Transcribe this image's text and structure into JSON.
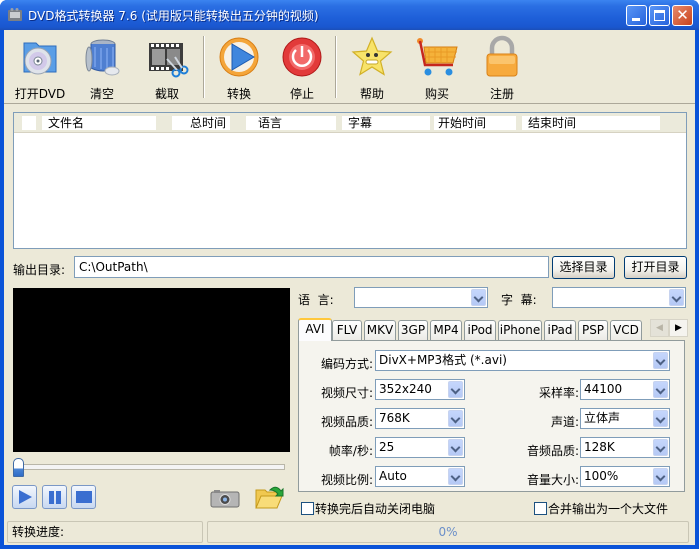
{
  "window": {
    "title": "DVD格式转换器 7.6 (试用版只能转换出五分钟的视频)",
    "controls": {
      "minimize": "minimize",
      "maximize": "maximize",
      "close": "✕"
    }
  },
  "toolbar": {
    "items": [
      {
        "label": "打开DVD",
        "icon": "open-dvd-icon"
      },
      {
        "label": "清空",
        "icon": "trash-icon"
      },
      {
        "label": "截取",
        "icon": "film-cut-icon"
      },
      {
        "label": "转换",
        "icon": "play-convert-icon"
      },
      {
        "label": "停止",
        "icon": "stop-power-icon"
      },
      {
        "label": "帮助",
        "icon": "star-help-icon"
      },
      {
        "label": "购买",
        "icon": "cart-icon"
      },
      {
        "label": "注册",
        "icon": "lock-icon"
      }
    ]
  },
  "file_list": {
    "columns": [
      "文件名",
      "总时间",
      "语言",
      "字幕",
      "开始时间",
      "结束时间"
    ],
    "rows": []
  },
  "output": {
    "label": "输出目录:",
    "path": "C:\\OutPath\\",
    "choose_button": "选择目录",
    "open_button": "打开目录"
  },
  "player": {
    "seek_position": 0,
    "buttons": [
      "play",
      "pause",
      "stop"
    ],
    "snapshot_icon": "camera-icon",
    "open_folder_icon": "folder-open-icon"
  },
  "audio_sub": {
    "language_label": "语  言:",
    "language_value": "",
    "subtitle_label": "字  幕:",
    "subtitle_value": ""
  },
  "format_tabs": {
    "tabs": [
      "AVI",
      "FLV",
      "MKV",
      "3GP",
      "MP4",
      "iPod",
      "iPhone",
      "iPad",
      "PSP",
      "VCD"
    ],
    "active": "AVI",
    "scroll_left": "◀",
    "scroll_right": "▶"
  },
  "settings": {
    "encoding": {
      "label": "编码方式:",
      "value": "DivX+MP3格式 (*.avi)"
    },
    "video_size": {
      "label": "视频尺寸:",
      "value": "352x240"
    },
    "video_quality": {
      "label": "视频品质:",
      "value": "768K"
    },
    "frame_rate": {
      "label": "帧率/秒:",
      "value": "25"
    },
    "aspect_ratio": {
      "label": "视频比例:",
      "value": "Auto"
    },
    "sample_rate": {
      "label": "采样率:",
      "value": "44100"
    },
    "channels": {
      "label": "声道:",
      "value": "立体声"
    },
    "audio_quality": {
      "label": "音频品质:",
      "value": "128K"
    },
    "volume": {
      "label": "音量大小:",
      "value": "100%"
    }
  },
  "options": {
    "auto_shutdown": {
      "label": "转换完后自动关闭电脑",
      "checked": false
    },
    "merge_output": {
      "label": "合并输出为一个大文件",
      "checked": false
    }
  },
  "status": {
    "progress_label": "转换进度:",
    "progress_percent": 0,
    "progress_text": "0%"
  }
}
